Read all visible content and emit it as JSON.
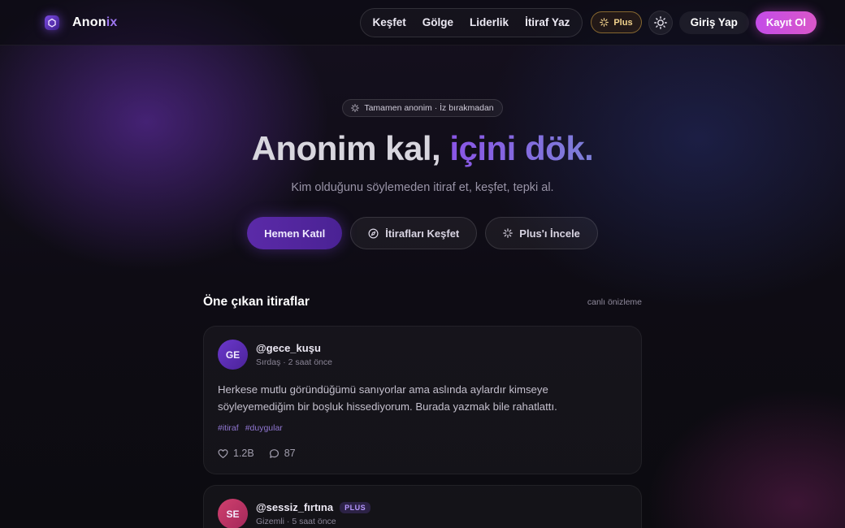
{
  "brand": {
    "name_main": "Anon",
    "name_accent": "ix"
  },
  "nav": {
    "links": [
      "Keşfet",
      "Gölge",
      "Liderlik",
      "İtiraf Yaz"
    ],
    "plus_label": "Plus",
    "login_label": "Giriş Yap",
    "register_label": "Kayıt Ol"
  },
  "hero": {
    "badge": "Tamamen anonim · İz bırakmadan",
    "title_plain": "Anonim kal, ",
    "title_accent": "içini dök.",
    "subtitle": "Kim olduğunu söylemeden itiraf et, keşfet, tepki al.",
    "cta_primary": "Hemen Katıl",
    "cta_explore": "İtirafları Keşfet",
    "cta_plus": "Plus'ı İncele"
  },
  "feed": {
    "title": "Öne çıkan itiraflar",
    "note": "canlı önizleme",
    "posts": [
      {
        "initials": "GE",
        "username": "@gece_kuşu",
        "meta": "Sırdaş · 2 saat önce",
        "body_line1": "Herkese mutlu göründüğümü sanıyorlar ama aslında aylardır kimseye",
        "body_line2": "söyleyemediğim bir boşluk hissediyorum. Burada yazmak bile rahatlattı.",
        "tags": [
          "#itiraf",
          "#duygular"
        ],
        "likes": "1.2B",
        "comments": "87"
      },
      {
        "initials": "SE",
        "username": "@sessiz_fırtına",
        "badge": "PLUS",
        "meta": "Gizemli · 5 saat önce"
      }
    ]
  },
  "colors": {
    "accent_purple": "#7b4ae2",
    "accent_pink": "#d957c9",
    "plus_gold": "#f2d38d"
  }
}
